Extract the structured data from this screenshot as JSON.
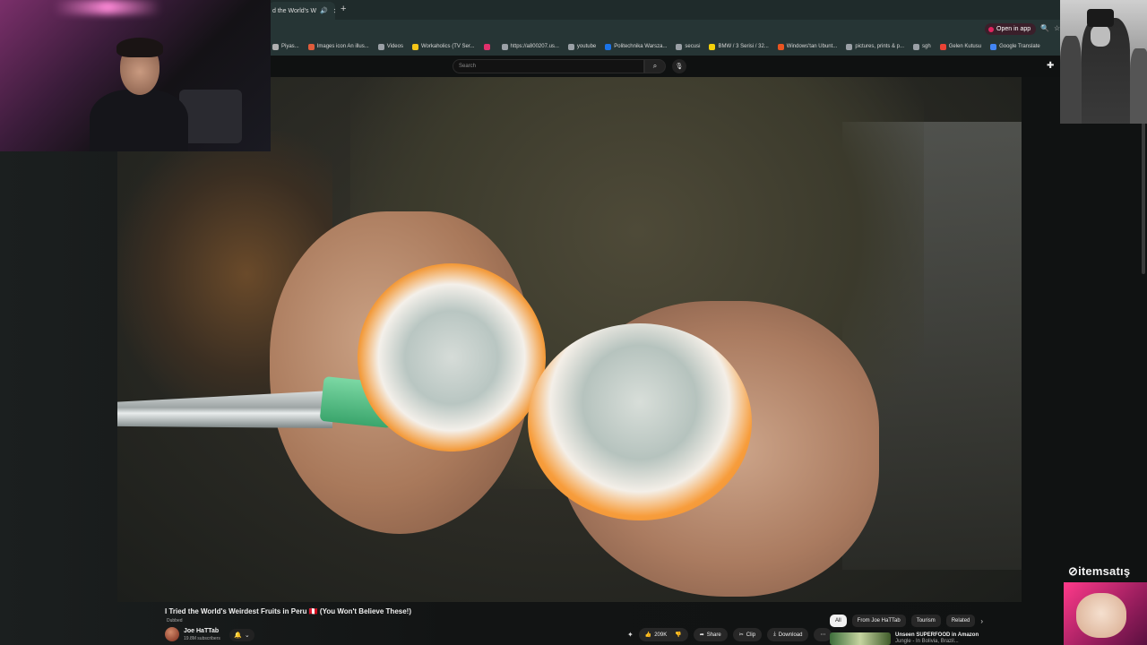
{
  "browser": {
    "tab_title": "d the World's W",
    "new_tab": "+",
    "open_in_app": "Open in app",
    "bookmarks": [
      {
        "label": "Piyas...",
        "color": "#b0b0b0"
      },
      {
        "label": "Images icon An illus...",
        "color": "#e05c3b"
      },
      {
        "label": "Videos",
        "color": "#9aa0a6"
      },
      {
        "label": "Workaholics (TV Ser...",
        "color": "#f5c518"
      },
      {
        "label": "",
        "color": "#e1306c"
      },
      {
        "label": "https://a800207.us...",
        "color": "#9aa0a6"
      },
      {
        "label": "youtube",
        "color": "#9aa0a6"
      },
      {
        "label": "Politechnika Warsza...",
        "color": "#1a73e8"
      },
      {
        "label": "secusi",
        "color": "#9aa0a6"
      },
      {
        "label": "BMW / 3 Serisi / 32...",
        "color": "#f5d10a"
      },
      {
        "label": "Windows'tan Ubunt...",
        "color": "#e95420"
      },
      {
        "label": "pictures, prints & p...",
        "color": "#9aa0a6"
      },
      {
        "label": "sgh",
        "color": "#9aa0a6"
      },
      {
        "label": "Gelen Kutusu",
        "color": "#ea4335"
      },
      {
        "label": "Google Translate",
        "color": "#4285f4"
      }
    ]
  },
  "youtube": {
    "search_placeholder": "Search",
    "video": {
      "title": "I Tried the World's Weirdest Fruits in Peru 🇵🇪 (You Won't Believe These!)",
      "dubbed": "Dubbed",
      "channel": "Joe HaTTab",
      "subscribers": "19.8M subscribers",
      "likes": "209K",
      "share": "Share",
      "clip": "Clip",
      "download": "Download"
    },
    "chips": [
      "All",
      "From Joe HaTTab",
      "Tourism",
      "Related"
    ],
    "recommended": {
      "title_line1": "Unseen SUPERFOOD in Amazon",
      "title_line2": "Jungle - In Bolivia, Brazil..."
    }
  },
  "overlay": {
    "brand": "itemsatış"
  },
  "icons": {
    "search": "search-icon",
    "mic": "mic-icon",
    "bell": "bell-icon",
    "like": "thumbs-up-icon",
    "dislike": "thumbs-down-icon",
    "share": "share-icon",
    "clip": "scissors-icon",
    "download": "download-icon"
  }
}
